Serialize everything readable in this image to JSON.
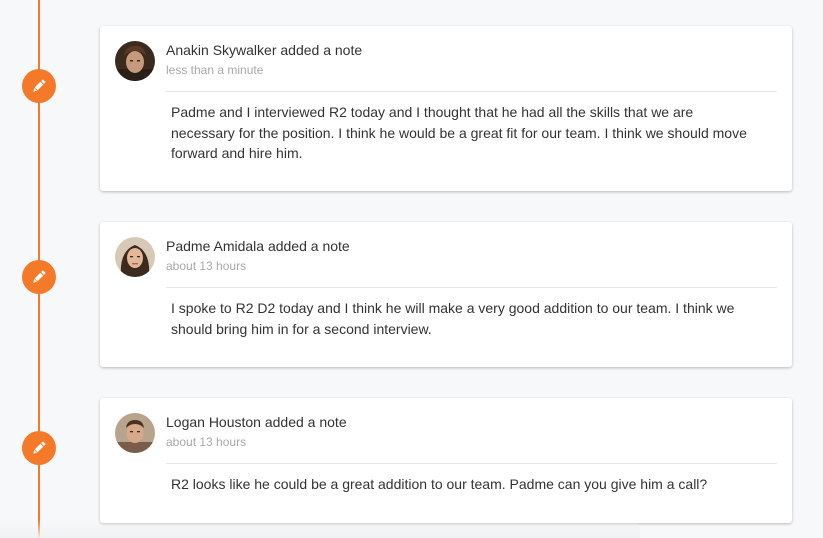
{
  "accent_color": "#f47a2a",
  "notes": [
    {
      "author": "Anakin Skywalker",
      "action": "added a note",
      "time": "less than a minute",
      "body": "Padme and I interviewed R2 today and I thought that he had all the skills that we are necessary for the position. I think he would be a great fit for our team. I think we should move forward and hire him.",
      "marker_icon": "pencil-icon"
    },
    {
      "author": "Padme Amidala",
      "action": "added a note",
      "time": "about 13 hours",
      "body": "I spoke to R2 D2 today and I think he will make a very good addition to our team. I think we should bring him in for a second interview.",
      "marker_icon": "pencil-icon"
    },
    {
      "author": "Logan Houston",
      "action": "added a note",
      "time": "about 13 hours",
      "body": "R2 looks like he could be a great addition to our team. Padme can you give him a call?",
      "marker_icon": "pencil-icon"
    }
  ]
}
